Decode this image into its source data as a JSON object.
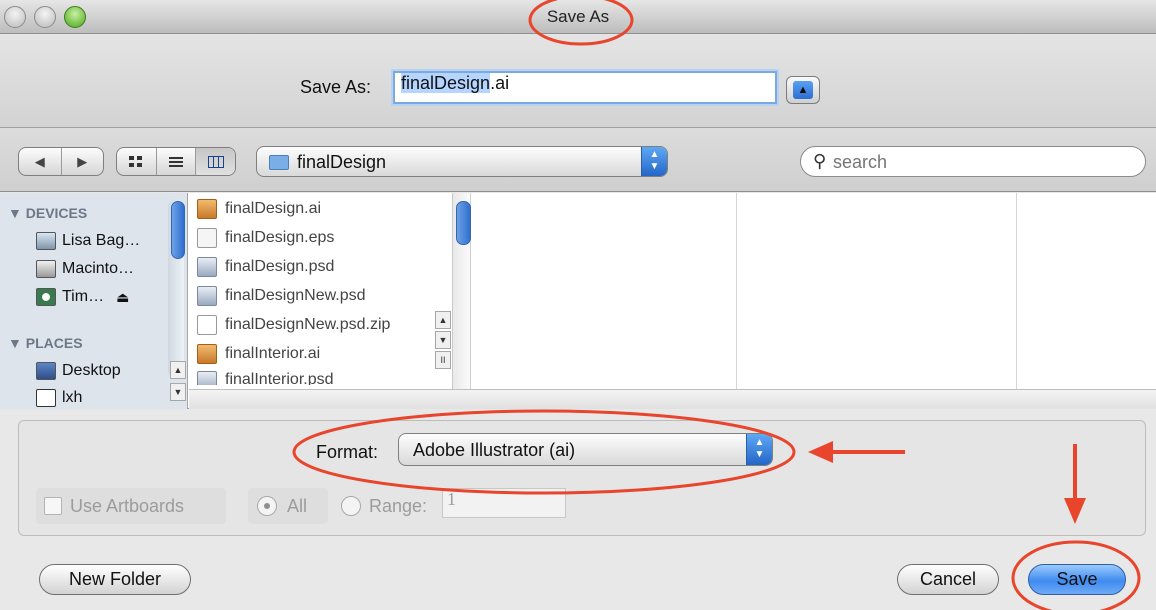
{
  "window": {
    "title": "Save As"
  },
  "save_as": {
    "label": "Save As:",
    "filename": "finalDesign.ai",
    "filename_selected": "finalDesign",
    "filename_ext": ".ai"
  },
  "toolbar": {
    "back_icon": "◀",
    "forward_icon": "▶",
    "views": [
      "icon-view",
      "list-view",
      "column-view"
    ],
    "active_view": "column-view",
    "current_folder": "finalDesign",
    "search_placeholder": "search"
  },
  "sidebar": {
    "devices_heading": "▼ DEVICES",
    "devices": [
      {
        "label": "Lisa Bag…",
        "icon": "laptop-icon"
      },
      {
        "label": "Macinto…",
        "icon": "hard-drive-icon"
      },
      {
        "label": "Tim…",
        "icon": "time-machine-icon"
      }
    ],
    "places_heading": "▼ PLACES",
    "places": [
      {
        "label": "Desktop",
        "icon": "desktop-icon"
      },
      {
        "label": "lxh",
        "icon": "home-icon"
      }
    ]
  },
  "files": [
    {
      "name": "finalDesign.ai",
      "icon": "illustrator-file-icon"
    },
    {
      "name": "finalDesign.eps",
      "icon": "eps-file-icon"
    },
    {
      "name": "finalDesign.psd",
      "icon": "psd-file-icon"
    },
    {
      "name": "finalDesignNew.psd",
      "icon": "psd-file-icon"
    },
    {
      "name": "finalDesignNew.psd.zip",
      "icon": "zip-file-icon"
    },
    {
      "name": "finalInterior.ai",
      "icon": "illustrator-file-icon"
    },
    {
      "name": "finalInterior.psd",
      "icon": "psd-file-icon"
    }
  ],
  "options": {
    "format_label": "Format:",
    "format_value": "Adobe Illustrator (ai)",
    "use_artboards_label": "Use Artboards",
    "use_artboards_checked": false,
    "all_label": "All",
    "range_label": "Range:",
    "range_value": "1"
  },
  "buttons": {
    "new_folder": "New Folder",
    "cancel": "Cancel",
    "save": "Save"
  },
  "colors": {
    "annotation": "#e8452c",
    "accent": "#3f8bef"
  }
}
